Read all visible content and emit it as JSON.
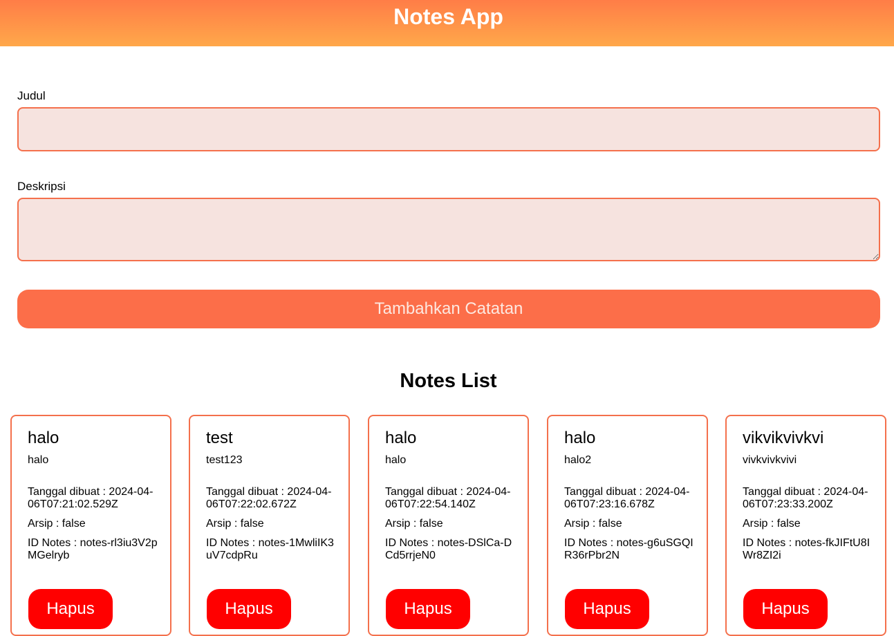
{
  "app": {
    "title": "Notes App"
  },
  "form": {
    "title_label": "Judul",
    "title_value": "",
    "description_label": "Deskripsi",
    "description_value": "",
    "submit_label": "Tambahkan Catatan"
  },
  "list": {
    "heading": "Notes List",
    "notes": [
      {
        "title": "halo",
        "body": "halo",
        "created": "Tanggal dibuat : 2024-04-06T07:21:02.529Z",
        "archived": "Arsip : false",
        "id": "ID Notes : notes-rl3iu3V2pMGelryb",
        "delete_label": "Hapus"
      },
      {
        "title": "test",
        "body": "test123",
        "created": "Tanggal dibuat : 2024-04-06T07:22:02.672Z",
        "archived": "Arsip : false",
        "id": "ID Notes : notes-1MwliIK3uV7cdpRu",
        "delete_label": "Hapus"
      },
      {
        "title": "halo",
        "body": "halo",
        "created": "Tanggal dibuat : 2024-04-06T07:22:54.140Z",
        "archived": "Arsip : false",
        "id": "ID Notes : notes-DSlCa-DCd5rrjeN0",
        "delete_label": "Hapus"
      },
      {
        "title": "halo",
        "body": "halo2",
        "created": "Tanggal dibuat : 2024-04-06T07:23:16.678Z",
        "archived": "Arsip : false",
        "id": "ID Notes : notes-g6uSGQIR36rPbr2N",
        "delete_label": "Hapus"
      },
      {
        "title": "vikvikvivkvi",
        "body": "vivkvivkvivi",
        "created": "Tanggal dibuat : 2024-04-06T07:23:33.200Z",
        "archived": "Arsip : false",
        "id": "ID Notes : notes-fkJIFtU8IWr8ZI2i",
        "delete_label": "Hapus"
      }
    ]
  },
  "colors": {
    "header_gradient_top": "#ff7d47",
    "header_gradient_bottom": "#ffa84a",
    "accent": "#f4704c",
    "field_background": "#f6e3df",
    "submit_button": "#fc6e49",
    "delete_button": "#ff0000"
  }
}
